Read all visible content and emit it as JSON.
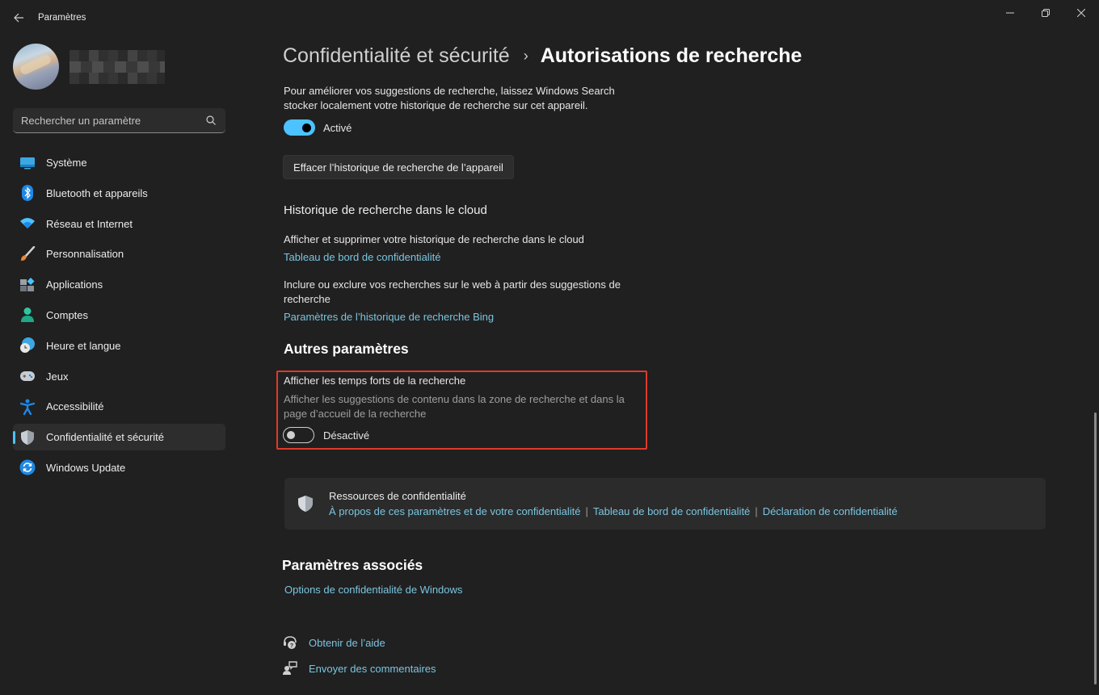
{
  "window": {
    "title": "Paramètres",
    "controls": {
      "minimize": "minimize",
      "maximize": "restore",
      "close": "close"
    }
  },
  "profile": {
    "name": "[masqué]"
  },
  "search": {
    "placeholder": "Rechercher un paramètre",
    "value": ""
  },
  "sidebar": {
    "items": [
      {
        "label": "Système",
        "icon": "system-icon"
      },
      {
        "label": "Bluetooth et appareils",
        "icon": "bluetooth-icon"
      },
      {
        "label": "Réseau et Internet",
        "icon": "wifi-icon"
      },
      {
        "label": "Personnalisation",
        "icon": "brush-icon"
      },
      {
        "label": "Applications",
        "icon": "apps-icon"
      },
      {
        "label": "Comptes",
        "icon": "account-icon"
      },
      {
        "label": "Heure et langue",
        "icon": "time-language-icon"
      },
      {
        "label": "Jeux",
        "icon": "gamepad-icon"
      },
      {
        "label": "Accessibilité",
        "icon": "accessibility-icon"
      },
      {
        "label": "Confidentialité et sécurité",
        "icon": "shield-icon",
        "active": true
      },
      {
        "label": "Windows Update",
        "icon": "windows-update-icon"
      }
    ]
  },
  "breadcrumb": {
    "parent": "Confidentialité et sécurité",
    "separator": "›",
    "current": "Autorisations de recherche"
  },
  "device_history": {
    "description": "Pour améliorer vos suggestions de recherche, laissez Windows Search stocker localement votre historique de recherche sur cet appareil.",
    "toggle_state": "on",
    "toggle_label": "Activé",
    "clear_button": "Effacer l’historique de recherche de l’appareil"
  },
  "cloud_history": {
    "heading": "Historique de recherche dans le cloud",
    "item1_text": "Afficher et supprimer votre historique de recherche dans le cloud",
    "item1_link": "Tableau de bord de confidentialité",
    "item2_text": "Inclure ou exclure vos recherches sur le web à partir des suggestions de recherche",
    "item2_link": "Paramètres de l’historique de recherche Bing"
  },
  "other_settings": {
    "heading": "Autres paramètres",
    "highlights_title": "Afficher les temps forts de la recherche",
    "highlights_desc": "Afficher les suggestions de contenu dans la zone de recherche et dans la page d’accueil de la recherche",
    "toggle_state": "off",
    "toggle_label": "Désactivé"
  },
  "privacy_resources": {
    "title": "Ressources de confidentialité",
    "links": [
      "À propos de ces paramètres et de votre confidentialité",
      "Tableau de bord de confidentialité",
      "Déclaration de confidentialité"
    ],
    "separator": "|"
  },
  "related": {
    "heading": "Paramètres associés",
    "link": "Options de confidentialité de Windows"
  },
  "footer": {
    "help": "Obtenir de l’aide",
    "feedback": "Envoyer des commentaires"
  },
  "colors": {
    "background": "#202020",
    "accent": "#4cc2ff",
    "link": "#7ac5e0",
    "highlight_border": "#e0392b",
    "card": "#2b2b2b"
  }
}
